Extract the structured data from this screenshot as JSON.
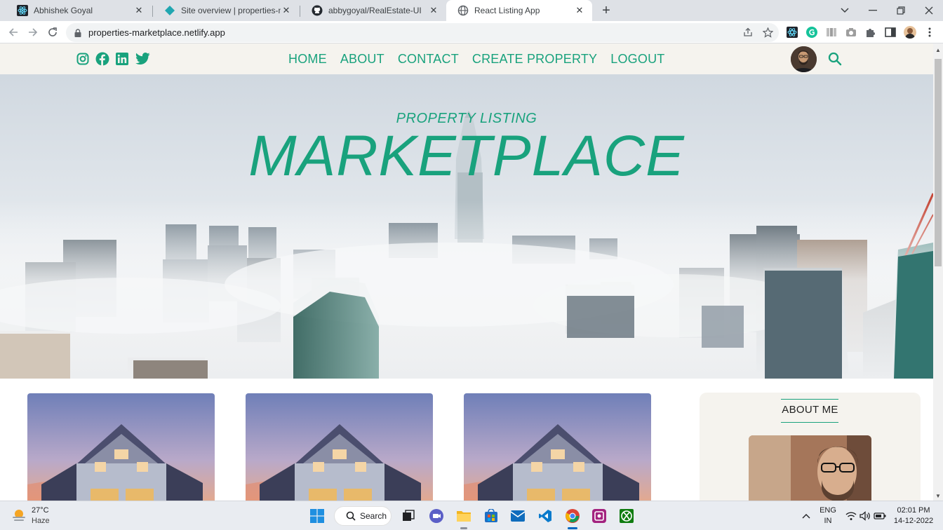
{
  "browser": {
    "tabs": [
      {
        "title": "Abhishek Goyal",
        "favicon": "react-icon",
        "active": false
      },
      {
        "title": "Site overview | properties-marketplace",
        "favicon": "netlify-icon",
        "active": false
      },
      {
        "title": "abbygoyal/RealEstate-UI",
        "favicon": "github-icon",
        "active": false
      },
      {
        "title": "React Listing App",
        "favicon": "globe-icon",
        "active": true
      }
    ],
    "url": "properties-marketplace.netlify.app"
  },
  "site": {
    "nav": [
      "HOME",
      "ABOUT",
      "CONTACT",
      "CREATE PROPERTY",
      "LOGOUT"
    ],
    "social": [
      "instagram-icon",
      "facebook-icon",
      "linkedin-icon",
      "twitter-icon"
    ],
    "hero": {
      "subtitle": "PROPERTY LISTING",
      "title": "MARKETPLACE"
    },
    "sidebar": {
      "title": "ABOUT ME"
    },
    "colors": {
      "accent": "#19a27d",
      "nav_bg": "#f5f3ee"
    }
  },
  "taskbar": {
    "weather": {
      "temp": "27°C",
      "desc": "Haze"
    },
    "search_label": "Search",
    "lang_top": "ENG",
    "lang_bottom": "IN",
    "time": "02:01 PM",
    "date": "14-12-2022"
  }
}
